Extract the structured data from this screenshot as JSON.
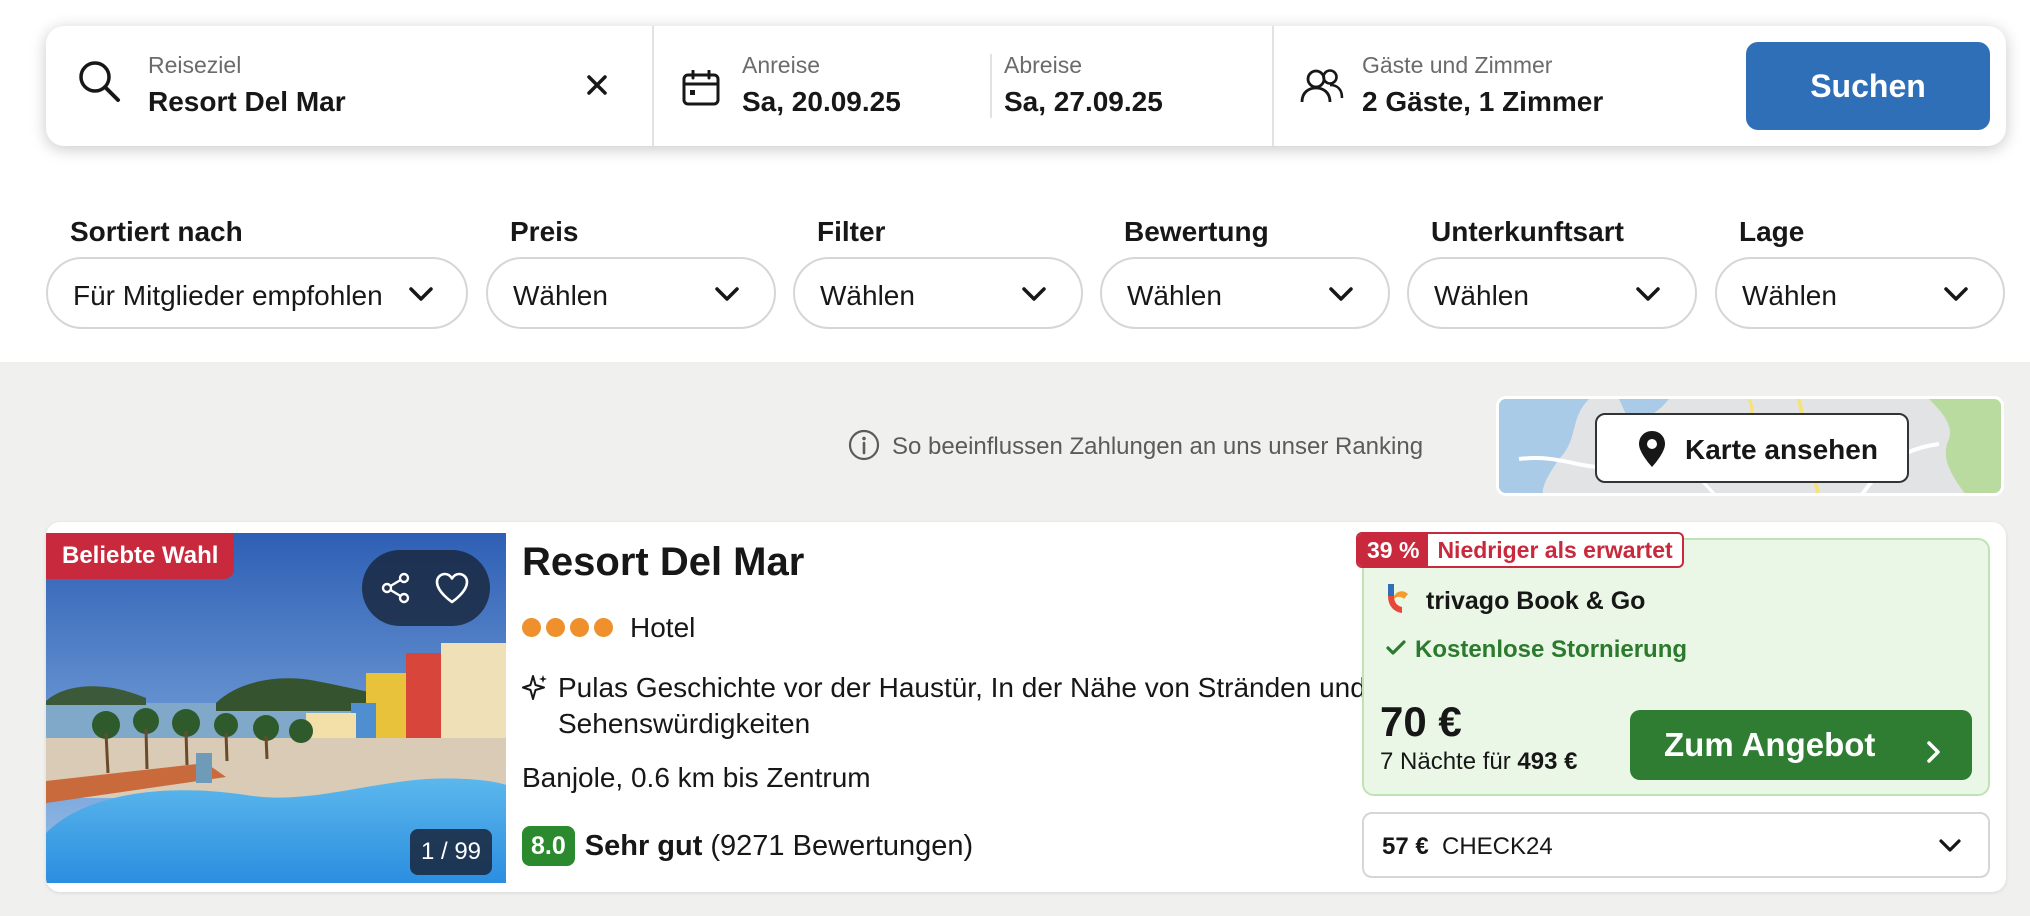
{
  "search": {
    "destination_label": "Reiseziel",
    "destination_value": "Resort Del Mar",
    "checkin_label": "Anreise",
    "checkin_value": "Sa, 20.09.25",
    "checkout_label": "Abreise",
    "checkout_value": "Sa, 27.09.25",
    "guests_label": "Gäste und Zimmer",
    "guests_value": "2 Gäste, 1 Zimmer",
    "search_button": "Suchen"
  },
  "filters": [
    {
      "label": "Sortiert nach",
      "value": "Für Mitglieder empfohlen"
    },
    {
      "label": "Preis",
      "value": "Wählen"
    },
    {
      "label": "Filter",
      "value": "Wählen"
    },
    {
      "label": "Bewertung",
      "value": "Wählen"
    },
    {
      "label": "Unterkunftsart",
      "value": "Wählen"
    },
    {
      "label": "Lage",
      "value": "Wählen"
    }
  ],
  "ranking_info": "So beeinflussen Zahlungen an uns unser Ranking",
  "map_button": "Karte ansehen",
  "result": {
    "badge": "Beliebte Wahl",
    "photo_counter": "1 / 99",
    "name": "Resort Del Mar",
    "stars": 4,
    "type": "Hotel",
    "highlight": "Pulas Geschichte vor der Haustür, In der Nähe von Stränden und Sehenswürdigkeiten",
    "location": "Banjole, 0.6 km bis Zentrum",
    "rating_score": "8.0",
    "rating_word": "Sehr gut",
    "rating_count": "(9271 Bewertungen)",
    "discount_pct": "39 %",
    "discount_text": "Niedriger als erwartet",
    "provider": "trivago Book & Go",
    "cancellation": "Kostenlose Stornierung",
    "price": "70 €",
    "nights_text": "7 Nächte für",
    "total_price": "493 €",
    "deal_button": "Zum Angebot",
    "alt_price": "57 €",
    "alt_provider": "CHECK24"
  },
  "colors": {
    "primary_blue": "#2f6fb8",
    "deal_green": "#2e7d32",
    "rating_green": "#2b8a2d",
    "badge_red": "#c8293c",
    "star_orange": "#f0902d",
    "deal_bg": "#ebf7e6"
  }
}
